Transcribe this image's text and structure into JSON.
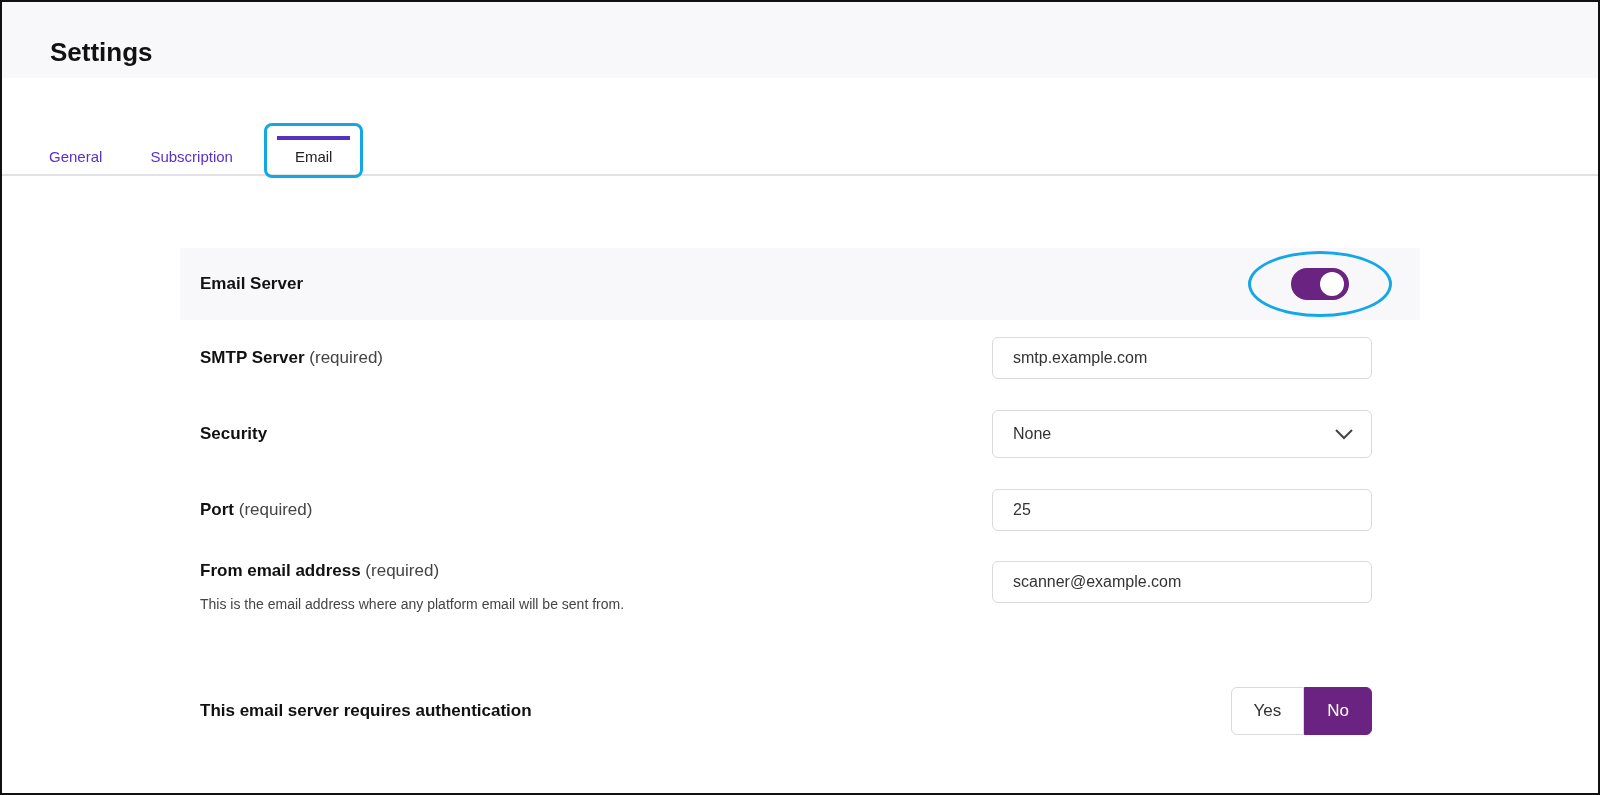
{
  "page": {
    "title": "Settings"
  },
  "tabs": [
    {
      "label": "General",
      "selected": false,
      "highlighted": false
    },
    {
      "label": "Subscription",
      "selected": false,
      "highlighted": false
    },
    {
      "label": "Email",
      "selected": true,
      "highlighted": true
    }
  ],
  "section": {
    "title": "Email Server",
    "on": true,
    "highlighted": true
  },
  "fields": [
    {
      "kind": "text",
      "label": "SMTP Server",
      "note": "(required)",
      "value": "smtp.example.com"
    },
    {
      "kind": "select",
      "label": "Security",
      "value": "None"
    },
    {
      "kind": "text",
      "label": "Port",
      "note": "(required)",
      "value": "25"
    },
    {
      "kind": "text",
      "label": "From email address",
      "note": "(required)",
      "description": "This is the email address where any platform email will be sent from.",
      "value": "scanner@example.com"
    },
    {
      "kind": "choice",
      "label": "This email server requires authentication",
      "options": [
        {
          "label": "Yes",
          "selected": false
        },
        {
          "label": "No",
          "selected": true
        }
      ]
    }
  ]
}
